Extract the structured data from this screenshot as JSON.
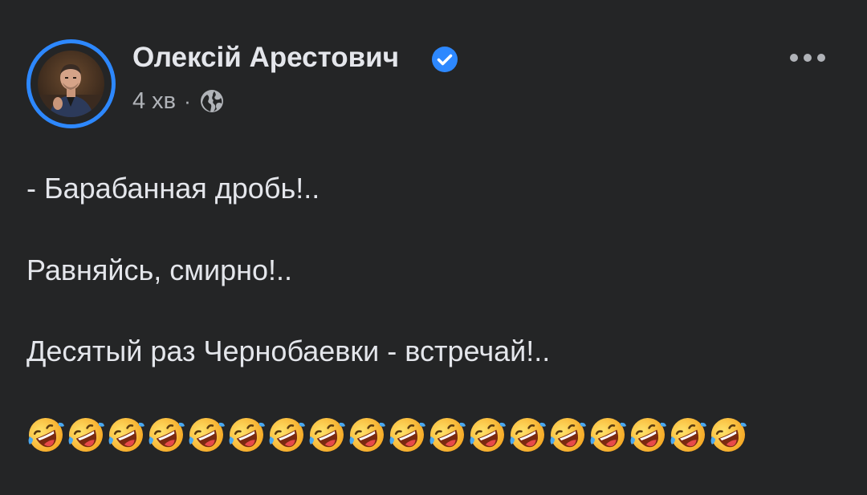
{
  "post": {
    "author": "Олексій Арестович",
    "verified": true,
    "time": "4 хв",
    "separator": "·",
    "audience_icon": "globe-icon",
    "more_icon": "more-dots-icon",
    "lines": [
      "- Барабанная дробь!..",
      "Равняйсь, смирно!..",
      "Десятый раз Чернобаевки - встречай!.."
    ],
    "emoji": {
      "name": "rolling-on-the-floor-laughing-emoji",
      "count": 18
    }
  },
  "colors": {
    "background": "#242526",
    "text_primary": "#e4e6eb",
    "text_secondary": "#b0b3b8",
    "accent_blue": "#2d88ff"
  }
}
